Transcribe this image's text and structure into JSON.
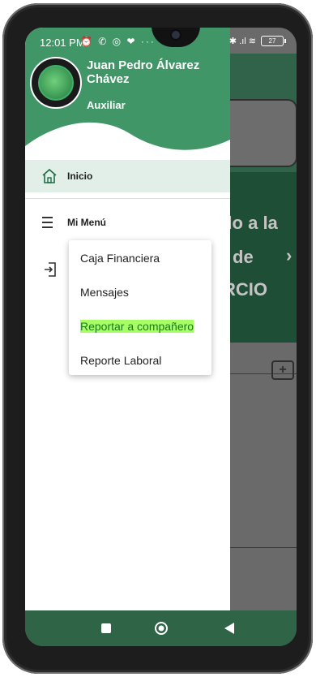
{
  "status_bar": {
    "time": "12:01 PM",
    "left_icons": "⏰ ✆ ◎ ❤ ···",
    "right_icons": "✱ .ıl ≋",
    "battery": "27"
  },
  "drawer": {
    "user_name": "Juan Pedro Álvarez Chávez",
    "user_role": "Auxiliar",
    "items": [
      {
        "label": "Inicio",
        "icon": "home-icon"
      },
      {
        "label": "Mi Menú",
        "icon": "menu-icon"
      },
      {
        "label": "",
        "icon": "logout-icon"
      }
    ]
  },
  "submenu": {
    "items": [
      "Caja Financiera",
      "Mensajes",
      "Reportar a compañero",
      "Reporte Laboral"
    ],
    "highlighted_index": 2
  },
  "background": {
    "banner_lines": [
      "ido a la",
      "de",
      "RCIO"
    ]
  },
  "colors": {
    "primary": "#409667",
    "highlight": "#a7ff65",
    "nav_bar": "#2f6447"
  }
}
